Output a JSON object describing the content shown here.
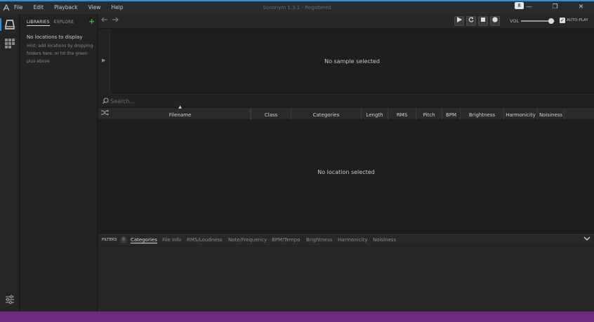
{
  "window": {
    "title": "Sononym 1.3.1 - Registered",
    "menu": [
      "File",
      "Edit",
      "Playback",
      "View",
      "Help"
    ],
    "badge": "8",
    "minimize": "—",
    "restore": "❐",
    "close": "✕"
  },
  "library": {
    "tabs": [
      "LIBRARIES",
      "EXPLORE"
    ],
    "add": "+",
    "empty_title": "No locations to display",
    "hint": "Hint: add locations by dropping folders here, or hit the green plus above"
  },
  "transport": {
    "volume_label": "VOL",
    "volume_level": 0.9,
    "autoplay_label": "AUTO-PLAY",
    "autoplay_checked": true
  },
  "preview": {
    "message": "No sample selected"
  },
  "search": {
    "placeholder": "Search..."
  },
  "table": {
    "columns": [
      "Filename",
      "Class",
      "Categories",
      "Length",
      "RMS",
      "Pitch",
      "BPM",
      "Brightness",
      "Harmonicity",
      "Noisiness"
    ],
    "empty_message": "No location selected"
  },
  "filters": {
    "title": "FILTERS",
    "count": "0",
    "tabs": [
      "Categories",
      "File Info",
      "RMS/Loudness",
      "Note/Frequency",
      "BPM/Tempo",
      "Brightness",
      "Harmonicity",
      "Noisiness"
    ]
  },
  "colors": {
    "accent": "#2f8fd8",
    "add": "#4caf50",
    "footer": "#6e2b80"
  }
}
